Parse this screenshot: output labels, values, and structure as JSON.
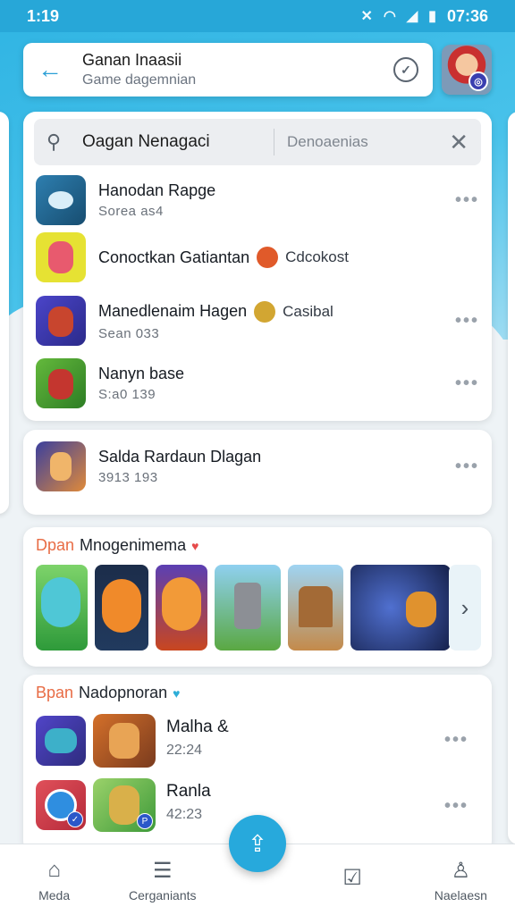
{
  "status": {
    "time": "1:19",
    "clock": "07:36"
  },
  "header": {
    "title": "Ganan Inaasii",
    "subtitle": "Game dagemnian"
  },
  "search": {
    "value": "Oagan Nenagaci",
    "placeholder": "Denoaenias"
  },
  "apps": [
    {
      "title": "Hanodan Rapge",
      "subtitle": "Sorea as4"
    },
    {
      "title": "Conoctkan Gatiantan",
      "tag": "Cdcokost"
    },
    {
      "title": "Manedlenaim Hagen",
      "tag": "Casibal",
      "subtitle": "Sean 033"
    },
    {
      "title": "Nanyn base",
      "subtitle": "S:a0 139"
    }
  ],
  "featured": {
    "title": "Salda Rardaun Dlagan",
    "subtitle": "3913 193"
  },
  "section1": {
    "accent": "Dpan",
    "title": "Mnogenimema"
  },
  "section2": {
    "accent": "Bpan",
    "title": "Nadopnoran"
  },
  "pairs": [
    {
      "title": "Malha &",
      "subtitle": "22:24"
    },
    {
      "title": "Ranla",
      "subtitle": "42:23"
    }
  ],
  "nav": [
    {
      "label": "Meda",
      "icon": "home-icon"
    },
    {
      "label": "Cerganiants",
      "icon": "list-icon"
    },
    {
      "label": "",
      "icon": "share-icon"
    },
    {
      "label": "",
      "icon": "checkbox-icon"
    },
    {
      "label": "Naelaesn",
      "icon": "person-icon"
    }
  ],
  "colors": {
    "brand": "#27a9dc",
    "accent": "#e86c45"
  }
}
